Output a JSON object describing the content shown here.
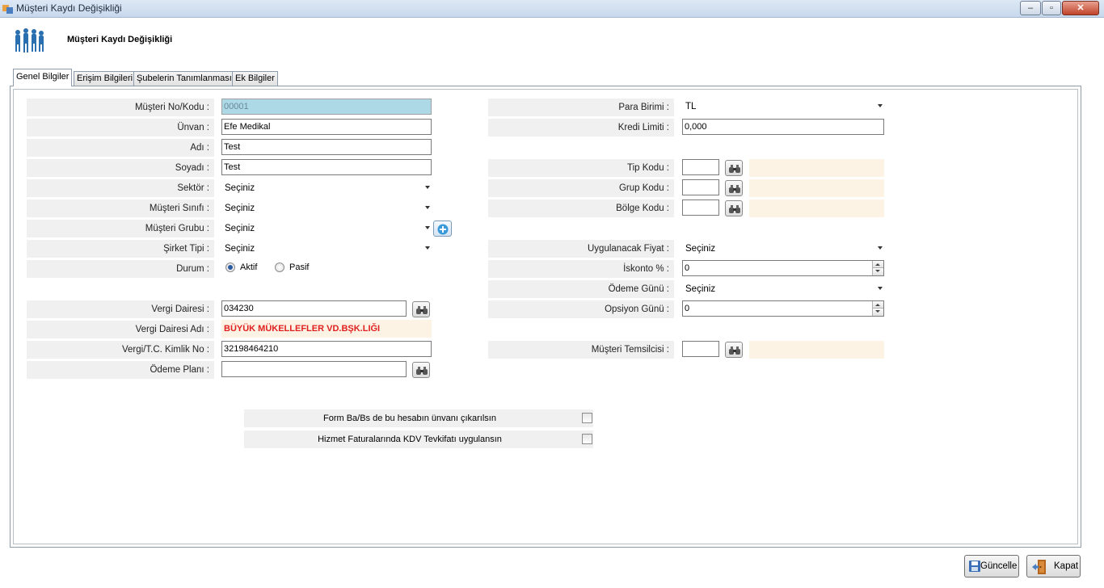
{
  "window": {
    "title": "Müşteri Kaydı Değişikliği",
    "min": "–",
    "max": "▫",
    "close": "✕"
  },
  "header": {
    "title": "Müşteri Kaydı Değişikliği"
  },
  "tabs": [
    {
      "label": "Genel Bilgiler"
    },
    {
      "label": "Erişim Bilgileri"
    },
    {
      "label": "Şubelerin Tanımlanması"
    },
    {
      "label": "Ek Bilgiler"
    }
  ],
  "left": {
    "customer_no": {
      "label": "Müşteri No/Kodu  :",
      "value": "00001"
    },
    "title": {
      "label": "Ünvan  :",
      "value": "Efe Medikal"
    },
    "first_name": {
      "label": "Adı  :",
      "value": "Test"
    },
    "last_name": {
      "label": "Soyadı  :",
      "value": "Test"
    },
    "sector": {
      "label": "Sektör  :",
      "value": "Seçiniz"
    },
    "customer_class": {
      "label": "Müşteri Sınıfı  :",
      "value": "Seçiniz"
    },
    "customer_group": {
      "label": "Müşteri Grubu  :",
      "value": "Seçiniz"
    },
    "company_type": {
      "label": "Şirket Tipi  :",
      "value": "Seçiniz"
    },
    "status": {
      "label": "Durum  :",
      "active": "Aktif",
      "passive": "Pasif"
    },
    "tax_office": {
      "label": "Vergi Dairesi  :",
      "value": "034230"
    },
    "tax_office_name": {
      "label": "Vergi Dairesi Adı  :",
      "value": "BÜYÜK MÜKELLEFLER VD.BŞK.LIĞI"
    },
    "tax_id": {
      "label": "Vergi/T.C. Kimlik No  :",
      "value": "32198464210"
    },
    "payment_plan": {
      "label": "Ödeme Planı  :",
      "value": ""
    }
  },
  "right": {
    "currency": {
      "label": "Para Birimi  :",
      "value": "TL"
    },
    "credit_limit": {
      "label": "Kredi Limiti  :",
      "value": "0,000"
    },
    "type_code": {
      "label": "Tip Kodu  :",
      "value": ""
    },
    "group_code": {
      "label": "Grup Kodu  :",
      "value": ""
    },
    "region_code": {
      "label": "Bölge Kodu  :",
      "value": ""
    },
    "price_to_apply": {
      "label": "Uygulanacak Fiyat  :",
      "value": "Seçiniz"
    },
    "discount": {
      "label": "İskonto %  :",
      "value": "0"
    },
    "payment_day": {
      "label": "Ödeme Günü  :",
      "value": "Seçiniz"
    },
    "option_day": {
      "label": "Opsiyon Günü  :",
      "value": "0"
    },
    "representative": {
      "label": "Müşteri Temsilcisi  :",
      "value": ""
    }
  },
  "checks": [
    {
      "label": "Form Ba/Bs de bu hesabın ünvanı çıkarılsın",
      "checked": false
    },
    {
      "label": "Hizmet Faturalarında KDV Tevkifatı uygulansın",
      "checked": false
    }
  ],
  "buttons": {
    "update": "Güncelle",
    "close": "Kapat"
  }
}
